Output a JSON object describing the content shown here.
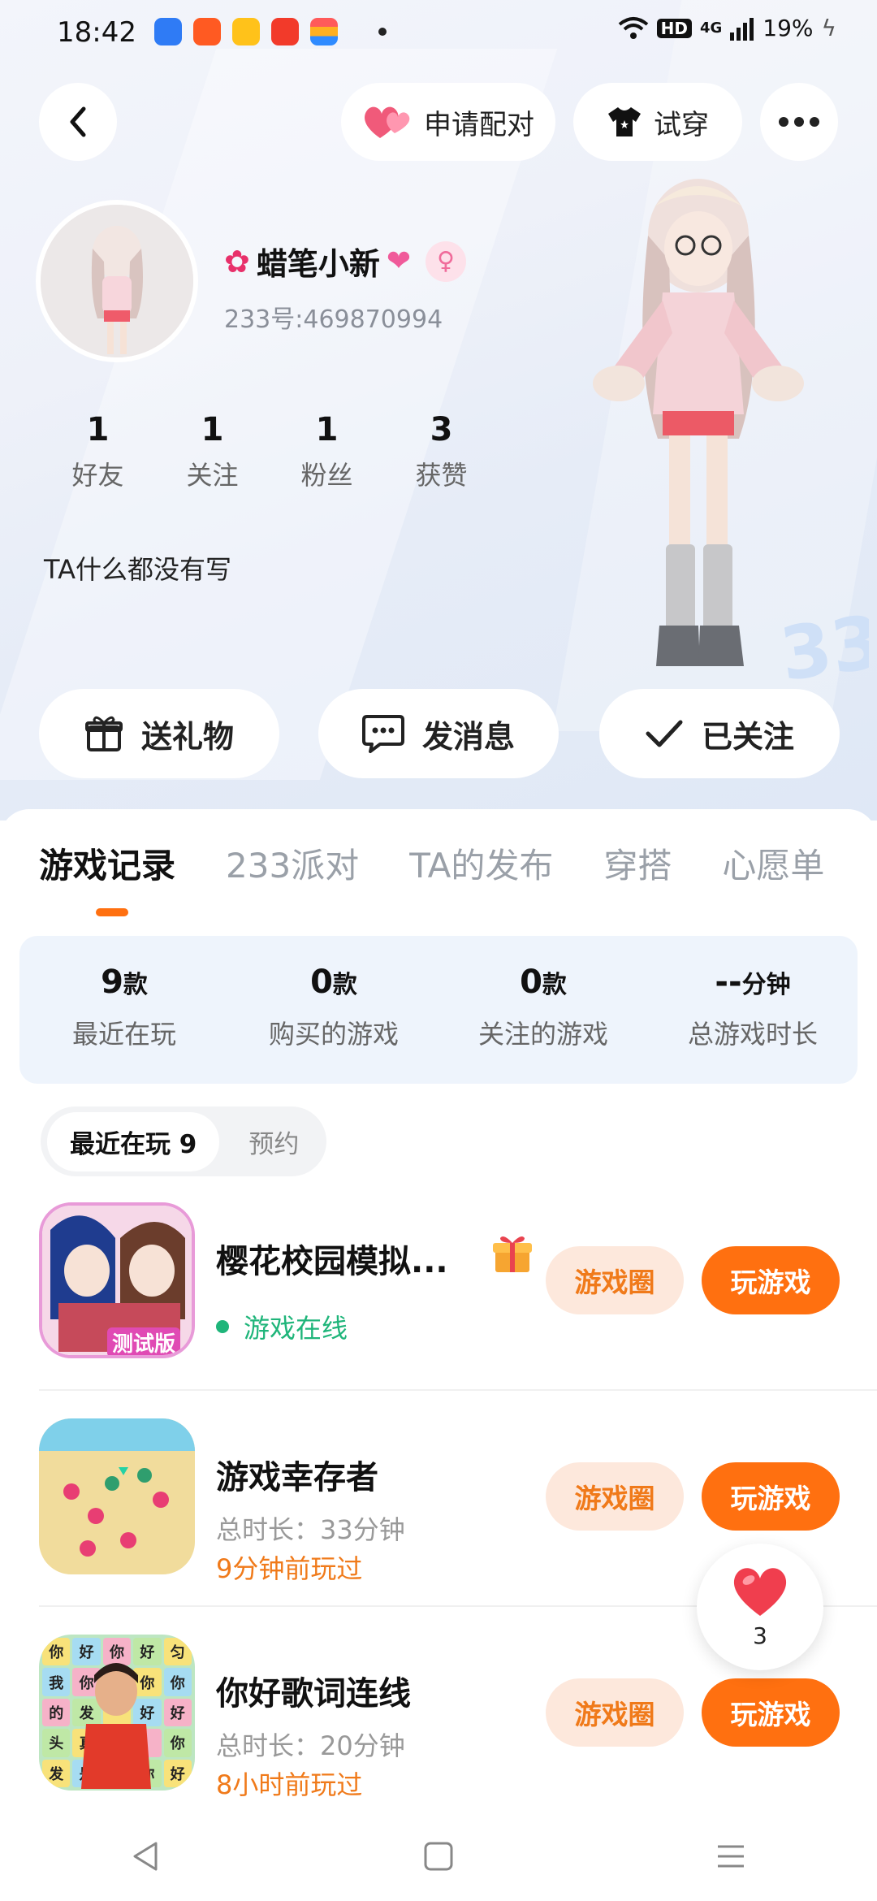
{
  "status_bar": {
    "time": "18:42",
    "hd": "HD",
    "network": "4G",
    "battery": "19%",
    "icons": [
      "blue-app-icon",
      "orange-app-icon",
      "yellow-app-icon",
      "red-video-icon",
      "wallet-icon",
      "dot-icon",
      "wifi-icon",
      "signal-icon",
      "charging-icon"
    ]
  },
  "header": {
    "pair_label": "申请配对",
    "try_on_label": "试穿"
  },
  "profile": {
    "name": "蜡笔小新",
    "id_text": "233号:469870994",
    "gender_symbol": "♀",
    "bio": "TA什么都没有写",
    "stats": [
      {
        "num": "1",
        "label": "好友"
      },
      {
        "num": "1",
        "label": "关注"
      },
      {
        "num": "1",
        "label": "粉丝"
      },
      {
        "num": "3",
        "label": "获赞"
      }
    ]
  },
  "actions": {
    "gift": "送礼物",
    "message": "发消息",
    "followed": "已关注"
  },
  "tabs": [
    "游戏记录",
    "233派对",
    "TA的发布",
    "穿搭",
    "心愿单"
  ],
  "summary": [
    {
      "value": "9",
      "unit": "款",
      "label": "最近在玩"
    },
    {
      "value": "0",
      "unit": "款",
      "label": "购买的游戏"
    },
    {
      "value": "0",
      "unit": "款",
      "label": "关注的游戏"
    },
    {
      "value": "--",
      "unit": "分钟",
      "label": "总游戏时长"
    }
  ],
  "segment": {
    "active": "最近在玩 9",
    "inactive": "预约"
  },
  "games": [
    {
      "title": "樱花校园模拟...",
      "status": "游戏在线",
      "badge": "测试版",
      "circle": "游戏圈",
      "play": "玩游戏"
    },
    {
      "title": "游戏幸存者",
      "duration": "总时长：33分钟",
      "last_played": "9分钟前玩过",
      "circle": "游戏圈",
      "play": "玩游戏"
    },
    {
      "title": "你好歌词连线",
      "duration": "总时长：20分钟",
      "last_played": "8小时前玩过",
      "circle": "游戏圈",
      "play": "玩游戏",
      "icon_chars": [
        "你",
        "好",
        "你",
        "好",
        "匀",
        "我",
        "你",
        "",
        "你",
        "你",
        "的",
        "发",
        "",
        "好",
        "好",
        "头",
        "真",
        "",
        "",
        "你",
        "发",
        "是",
        "",
        "你",
        "好"
      ]
    }
  ],
  "like_count": "3",
  "colors": {
    "accent": "#ff7010",
    "online": "#1fb57a",
    "pink": "#f06c9b"
  }
}
